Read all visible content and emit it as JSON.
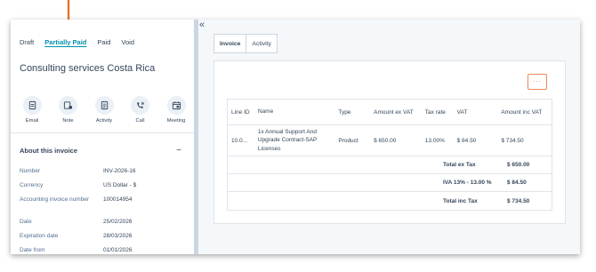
{
  "colors": {
    "accent": "#0091ae",
    "arrow": "#e8742a",
    "more_button": "#e8875a"
  },
  "status_tabs": [
    {
      "label": "Draft",
      "active": false
    },
    {
      "label": "Partially Paid",
      "active": true
    },
    {
      "label": "Paid",
      "active": false
    },
    {
      "label": "Void",
      "active": false
    }
  ],
  "record_title": "Consulting services Costa Rica",
  "actions": [
    {
      "label": "Email",
      "icon": "email-icon"
    },
    {
      "label": "Note",
      "icon": "note-icon"
    },
    {
      "label": "Activity",
      "icon": "activity-icon"
    },
    {
      "label": "Call",
      "icon": "call-icon"
    },
    {
      "label": "Meeting",
      "icon": "meeting-icon"
    }
  ],
  "about": {
    "title": "About this invoice",
    "toggle": "−",
    "properties": [
      {
        "label": "Number",
        "value": "INV-2026-16"
      },
      {
        "label": "Currency",
        "value": "US Dollar - $"
      },
      {
        "label": "Accounting invoice number",
        "value": "100014954"
      },
      {
        "label": "Date",
        "value": "25/02/2026"
      },
      {
        "label": "Expiration date",
        "value": "28/03/2026"
      },
      {
        "label": "Date from",
        "value": "01/01/2026"
      }
    ]
  },
  "collapse_icon": "«",
  "tabs": [
    {
      "label": "Invoice",
      "active": true
    },
    {
      "label": "Activity",
      "active": false
    }
  ],
  "more_button": "···",
  "line_items": {
    "headers": [
      "Line ID",
      "Name",
      "Type",
      "Amount ex VAT",
      "Tax rate",
      "VAT",
      "Amount inc VAT"
    ],
    "rows": [
      {
        "id": "10.0...",
        "name": "1x Annual Support And Upgrade Contract-SAP Licenses",
        "type": "Product",
        "amount_ex": "$ 650.00",
        "tax_rate": "13.00%",
        "vat": "$ 84.50",
        "amount_inc": "$ 734.50"
      }
    ],
    "totals": [
      {
        "label": "Total ex Tax",
        "value": "$ 650.00"
      },
      {
        "label": "IVA 13% - 13.00 %",
        "value": "$ 84.50"
      },
      {
        "label": "Total inc Tax",
        "value": "$ 734.50"
      }
    ]
  }
}
